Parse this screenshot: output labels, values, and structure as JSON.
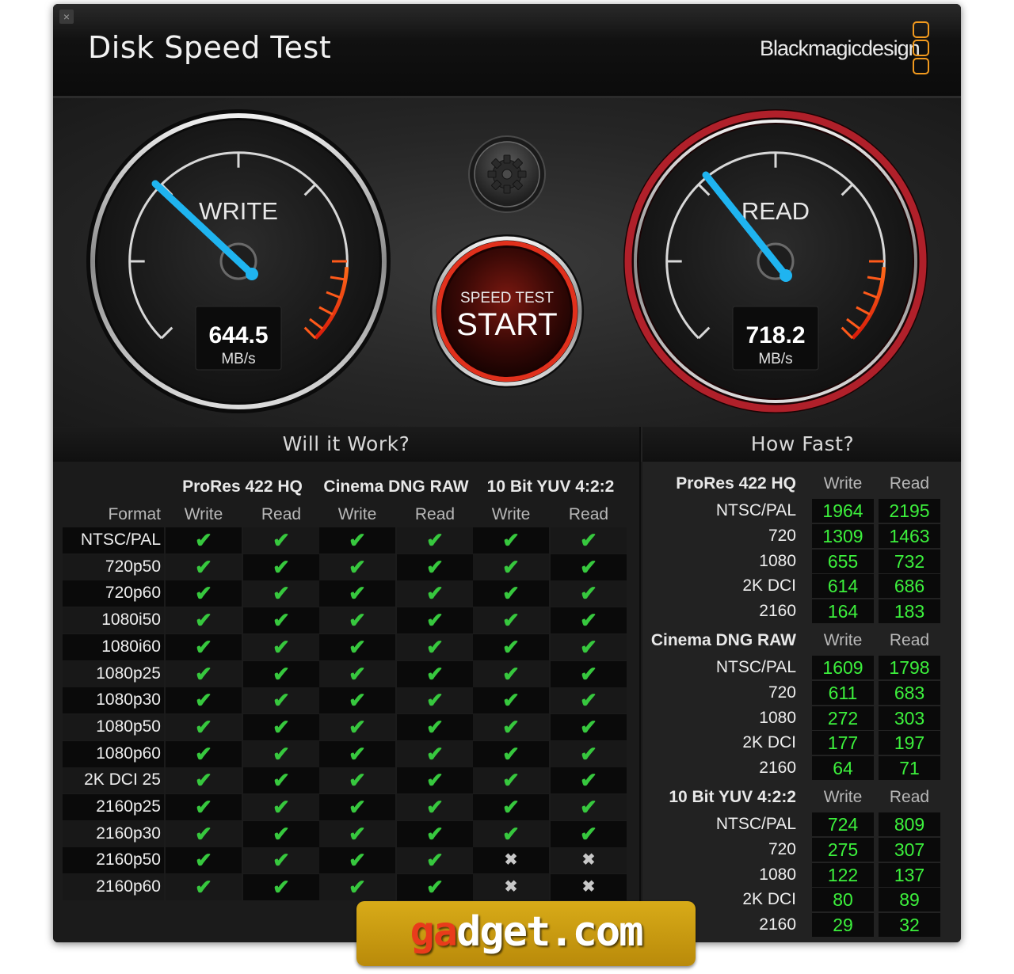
{
  "window": {
    "title": "Disk Speed Test",
    "brand": "Blackmagicdesign",
    "close_icon": "×"
  },
  "gauges": {
    "write": {
      "label": "WRITE",
      "value": "644.5",
      "unit": "MB/s"
    },
    "read": {
      "label": "READ",
      "value": "718.2",
      "unit": "MB/s"
    },
    "settings_icon": "gear-icon",
    "start_button": {
      "caption": "SPEED TEST",
      "label": "START"
    }
  },
  "will_it_work": {
    "title": "Will it Work?",
    "format_header": "Format",
    "codecs": [
      "ProRes 422 HQ",
      "Cinema DNG RAW",
      "10 Bit YUV 4:2:2"
    ],
    "subcolumns": [
      "Write",
      "Read",
      "Write",
      "Read",
      "Write",
      "Read"
    ],
    "rows": [
      {
        "format": "NTSC/PAL",
        "results": [
          true,
          true,
          true,
          true,
          true,
          true
        ]
      },
      {
        "format": "720p50",
        "results": [
          true,
          true,
          true,
          true,
          true,
          true
        ]
      },
      {
        "format": "720p60",
        "results": [
          true,
          true,
          true,
          true,
          true,
          true
        ]
      },
      {
        "format": "1080i50",
        "results": [
          true,
          true,
          true,
          true,
          true,
          true
        ]
      },
      {
        "format": "1080i60",
        "results": [
          true,
          true,
          true,
          true,
          true,
          true
        ]
      },
      {
        "format": "1080p25",
        "results": [
          true,
          true,
          true,
          true,
          true,
          true
        ]
      },
      {
        "format": "1080p30",
        "results": [
          true,
          true,
          true,
          true,
          true,
          true
        ]
      },
      {
        "format": "1080p50",
        "results": [
          true,
          true,
          true,
          true,
          true,
          true
        ]
      },
      {
        "format": "1080p60",
        "results": [
          true,
          true,
          true,
          true,
          true,
          true
        ]
      },
      {
        "format": "2K DCI 25",
        "results": [
          true,
          true,
          true,
          true,
          true,
          true
        ]
      },
      {
        "format": "2160p25",
        "results": [
          true,
          true,
          true,
          true,
          true,
          true
        ]
      },
      {
        "format": "2160p30",
        "results": [
          true,
          true,
          true,
          true,
          true,
          true
        ]
      },
      {
        "format": "2160p50",
        "results": [
          true,
          true,
          true,
          true,
          false,
          false
        ]
      },
      {
        "format": "2160p60",
        "results": [
          true,
          true,
          true,
          true,
          false,
          false
        ]
      }
    ],
    "check_glyph": "✔",
    "cross_glyph": "✖"
  },
  "how_fast": {
    "title": "How Fast?",
    "sections": [
      {
        "codec": "ProRes 422 HQ",
        "write_label": "Write",
        "read_label": "Read",
        "rows": [
          {
            "format": "NTSC/PAL",
            "write": "1964",
            "read": "2195"
          },
          {
            "format": "720",
            "write": "1309",
            "read": "1463"
          },
          {
            "format": "1080",
            "write": "655",
            "read": "732"
          },
          {
            "format": "2K DCI",
            "write": "614",
            "read": "686"
          },
          {
            "format": "2160",
            "write": "164",
            "read": "183"
          }
        ]
      },
      {
        "codec": "Cinema DNG RAW",
        "write_label": "Write",
        "read_label": "Read",
        "rows": [
          {
            "format": "NTSC/PAL",
            "write": "1609",
            "read": "1798"
          },
          {
            "format": "720",
            "write": "611",
            "read": "683"
          },
          {
            "format": "1080",
            "write": "272",
            "read": "303"
          },
          {
            "format": "2K DCI",
            "write": "177",
            "read": "197"
          },
          {
            "format": "2160",
            "write": "64",
            "read": "71"
          }
        ]
      },
      {
        "codec": "10 Bit YUV 4:2:2",
        "write_label": "Write",
        "read_label": "Read",
        "rows": [
          {
            "format": "NTSC/PAL",
            "write": "724",
            "read": "809"
          },
          {
            "format": "720",
            "write": "275",
            "read": "307"
          },
          {
            "format": "1080",
            "write": "122",
            "read": "137"
          },
          {
            "format": "2K DCI",
            "write": "80",
            "read": "89"
          },
          {
            "format": "2160",
            "write": "29",
            "read": "32"
          }
        ]
      }
    ]
  },
  "watermark": {
    "prefix": "ga",
    "rest": "dget.com"
  },
  "colors": {
    "check": "#37c83e",
    "value_green": "#3cf03c",
    "needle": "#1fb4f0",
    "read_ring": "#b0202a",
    "brand_orange": "#f29a1e"
  }
}
